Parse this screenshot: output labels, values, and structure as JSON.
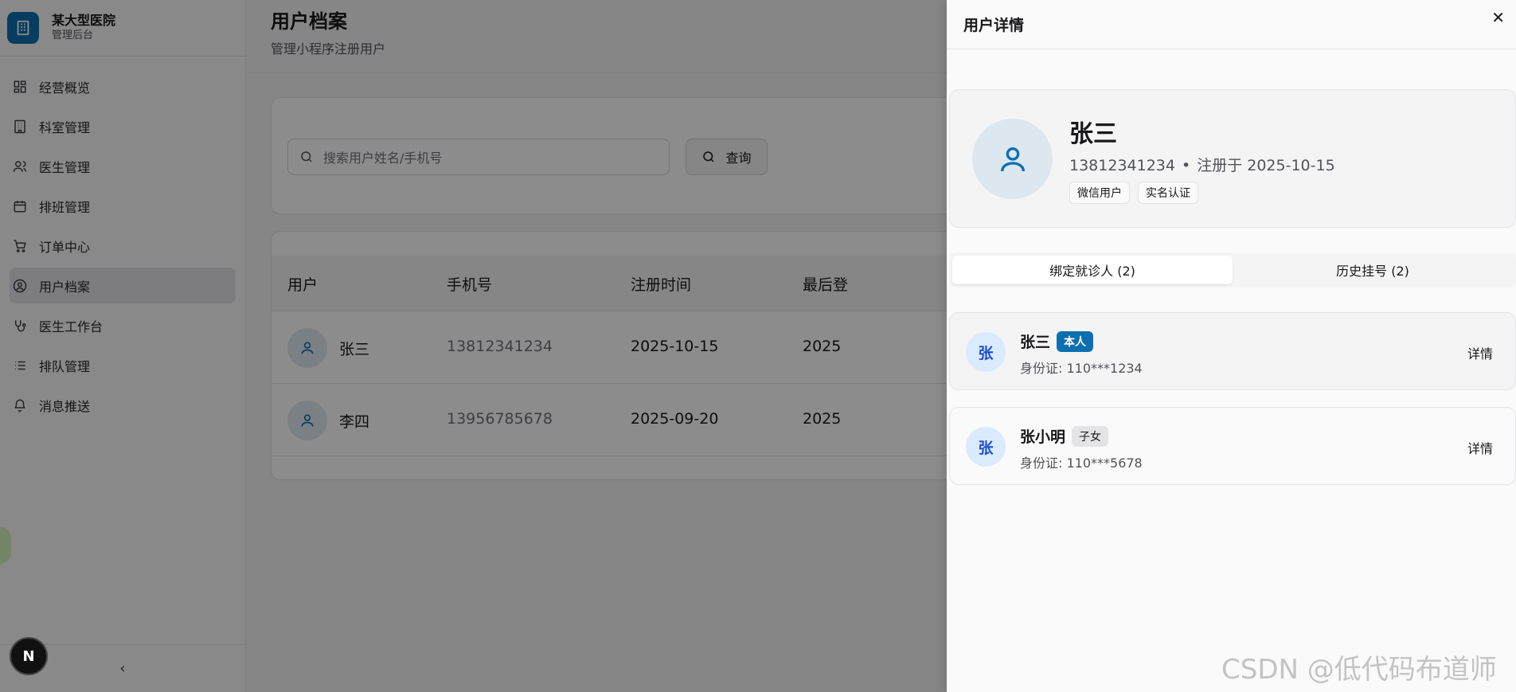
{
  "brand": {
    "name": "某大型医院",
    "subtitle": "管理后台",
    "color": "#0c6fb0"
  },
  "sidebar": {
    "items": [
      {
        "label": "经营概览",
        "icon": "dashboard-icon",
        "active": false
      },
      {
        "label": "科室管理",
        "icon": "building-icon",
        "active": false
      },
      {
        "label": "医生管理",
        "icon": "users-icon",
        "active": false
      },
      {
        "label": "排班管理",
        "icon": "calendar-icon",
        "active": false
      },
      {
        "label": "订单中心",
        "icon": "cart-icon",
        "active": false
      },
      {
        "label": "用户档案",
        "icon": "user-circle-icon",
        "active": true
      },
      {
        "label": "医生工作台",
        "icon": "stethoscope-icon",
        "active": false
      },
      {
        "label": "排队管理",
        "icon": "list-icon",
        "active": false
      },
      {
        "label": "消息推送",
        "icon": "bell-icon",
        "active": false
      }
    ],
    "collapse_glyph": "‹",
    "dev_badge": "N"
  },
  "page": {
    "title": "用户档案",
    "subtitle": "管理小程序注册用户"
  },
  "search": {
    "placeholder": "搜索用户姓名/手机号",
    "button_label": "查询"
  },
  "table": {
    "headers": [
      "用户",
      "手机号",
      "注册时间",
      "最后登"
    ],
    "rows": [
      {
        "name": "张三",
        "phone": "13812341234",
        "registered": "2025-10-15",
        "last": "2025"
      },
      {
        "name": "李四",
        "phone": "13956785678",
        "registered": "2025-09-20",
        "last": "2025"
      }
    ]
  },
  "drawer": {
    "title": "用户详情",
    "close_glyph": "✕",
    "profile": {
      "name": "张三",
      "phone": "13812341234",
      "dot": "•",
      "registered": "注册于 2025-10-15",
      "tags": [
        "微信用户",
        "实名认证"
      ]
    },
    "tabs": [
      {
        "label": "绑定就诊人 (2)",
        "active": true
      },
      {
        "label": "历史挂号 (2)",
        "active": false
      }
    ],
    "patients": [
      {
        "avatar": "张",
        "name": "张三",
        "relation": "本人",
        "id_text": "身份证: 110***1234",
        "detail_label": "详情"
      },
      {
        "avatar": "张",
        "name": "张小明",
        "relation": "子女",
        "id_text": "身份证: 110***5678",
        "detail_label": "详情"
      }
    ]
  },
  "watermark": "CSDN @低代码布道师"
}
